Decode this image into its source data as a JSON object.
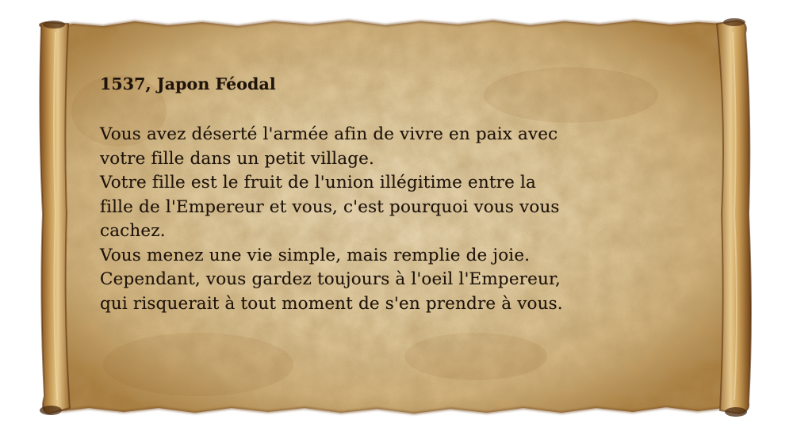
{
  "scroll": {
    "title": "1537, Japon Féodal",
    "lines": [
      "Vous avez déserté l'armée afin de vivre en paix avec",
      "votre fille dans un petit village.",
      "Votre fille est le fruit de l'union illégitime entre la",
      "fille de l'Empereur et vous, c'est pourquoi vous vous",
      "cachez.",
      "Vous menez une vie simple, mais remplie de joie.",
      "Cependant, vous gardez toujours à l'oeil l'Empereur,",
      "qui risquerait à tout moment de s'en prendre à vous."
    ]
  },
  "colors": {
    "background": "#ffffff",
    "parchment_light": "#f1e2bf",
    "parchment_mid": "#d9c08c",
    "parchment_dark": "#9a6a2f",
    "text": "#1f140b"
  }
}
